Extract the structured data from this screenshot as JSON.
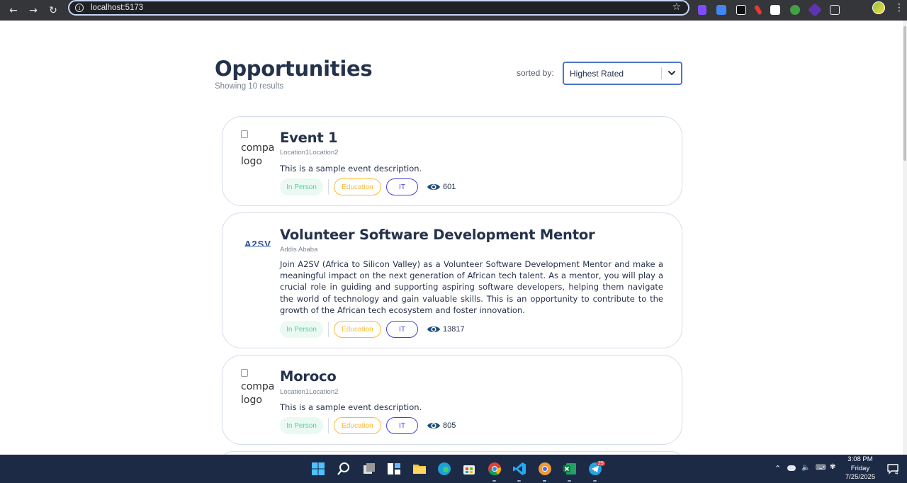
{
  "browser": {
    "url": "localhost:5173"
  },
  "page": {
    "title": "Opportunities",
    "result_count": "Showing 10 results",
    "sort_label": "sorted by:",
    "sort_value": "Highest Rated"
  },
  "cards": [
    {
      "logo_alt": "company logo",
      "title": "Event 1",
      "location": "Location1Location2",
      "description": "This is a sample event description.",
      "tags": [
        "In Person",
        "Education",
        "IT"
      ],
      "views": "601"
    },
    {
      "logo_text": "A2SV",
      "title": "Volunteer Software Development Mentor",
      "location": "Addis Ababa",
      "description": "Join A2SV (Africa to Silicon Valley) as a Volunteer Software Development Mentor and make a meaningful impact on the next generation of African tech talent. As a mentor, you will play a crucial role in guiding and supporting aspiring software developers, helping them navigate the world of technology and gain valuable skills. This is an opportunity to contribute to the growth of the African tech ecosystem and foster innovation.",
      "tags": [
        "In Person",
        "Education",
        "IT"
      ],
      "views": "13817"
    },
    {
      "logo_alt": "company logo",
      "title": "Moroco",
      "location": "Location1Location2",
      "description": "This is a sample event description.",
      "tags": [
        "In Person",
        "Education",
        "IT"
      ],
      "views": "805"
    }
  ],
  "taskbar": {
    "time": "3:08 PM",
    "day": "Friday",
    "date": "7/25/2025",
    "telegram_badge": "25",
    "notification_count": "4"
  },
  "colors": {
    "title": "#25324b",
    "muted": "#7c8493",
    "inperson_bg": "#eafaf2",
    "inperson_fg": "#56cdad",
    "education": "#ffb836",
    "it": "#4640de",
    "select_border": "#4b76c4"
  }
}
